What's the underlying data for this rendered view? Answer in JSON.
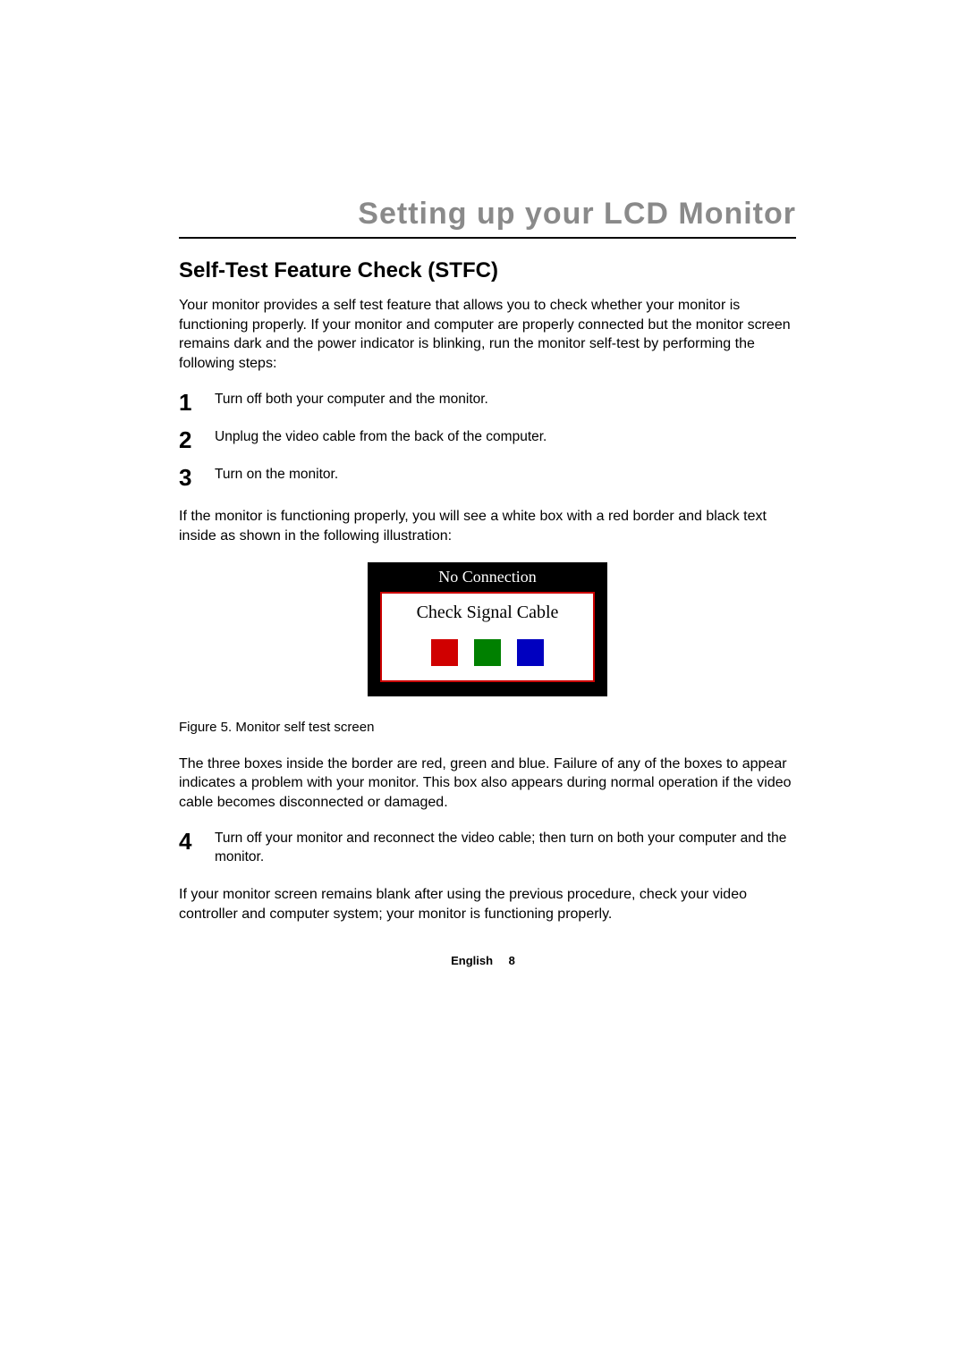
{
  "chapter_title": "Setting up your LCD Monitor",
  "section_title": "Self-Test Feature Check (STFC)",
  "intro": "Your monitor provides a self test feature that allows you to check whether your monitor is functioning properly. If your monitor and computer are properly connected but the monitor screen remains dark and the power indicator is blinking, run the monitor self-test by performing the following steps:",
  "steps_a": [
    {
      "n": "1",
      "text": "Turn off both your computer and the monitor."
    },
    {
      "n": "2",
      "text": "Unplug the video cable from the back of the computer."
    },
    {
      "n": "3",
      "text": "Turn on the monitor."
    }
  ],
  "after_steps_a": "If the monitor is functioning properly, you will see a white box with a red border and black text inside as shown in the following illustration:",
  "stfc_box": {
    "header": "No Connection",
    "message": "Check Signal Cable",
    "swatch_colors": [
      "red",
      "green",
      "blue"
    ]
  },
  "figure_caption": "Figure 5. Monitor self test screen",
  "after_figure": "The three boxes inside the border are red, green and blue. Failure of any of the boxes to appear indicates a problem with your monitor. This box also appears during normal operation if the video cable becomes disconnected or damaged.",
  "steps_b": [
    {
      "n": "4",
      "text": "Turn off your monitor and reconnect the video cable; then turn on both your computer and the monitor."
    }
  ],
  "closing": "If your monitor screen remains blank after using the previous procedure, check your video controller and computer system; your monitor is functioning properly.",
  "footer": {
    "language": "English",
    "page": "8"
  }
}
